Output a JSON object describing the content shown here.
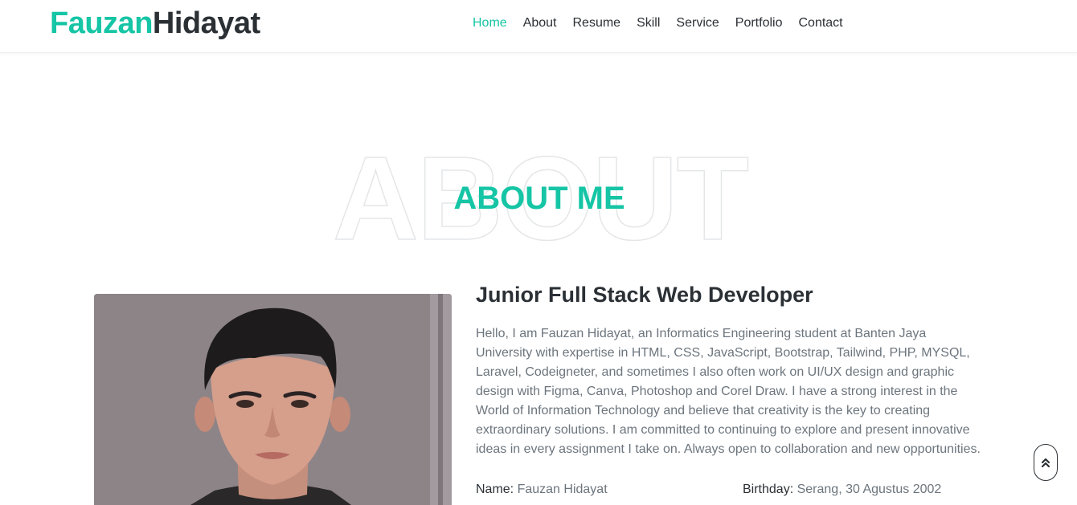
{
  "brand": {
    "first": "Fauzan",
    "last": "Hidayat"
  },
  "nav": {
    "items": [
      {
        "label": "Home",
        "active": true
      },
      {
        "label": "About",
        "active": false
      },
      {
        "label": "Resume",
        "active": false
      },
      {
        "label": "Skill",
        "active": false
      },
      {
        "label": "Service",
        "active": false
      },
      {
        "label": "Portfolio",
        "active": false
      },
      {
        "label": "Contact",
        "active": false
      }
    ]
  },
  "about": {
    "background_word": "ABOUT",
    "title": "ABOUT ME",
    "role": "Junior Full Stack Web Developer",
    "bio": "Hello, I am Fauzan Hidayat, an Informatics Engineering student at Banten Jaya University with expertise in HTML, CSS, JavaScript, Bootstrap, Tailwind, PHP, MYSQL, Laravel, Codeigneter, and sometimes I also often work on UI/UX design and graphic design with Figma, Canva, Photoshop and Corel Draw. I have a strong interest in the World of Information Technology and believe that creativity is the key to creating extraordinary solutions. I am committed to continuing to explore and present innovative ideas in every assignment I take on. Always open to collaboration and new opportunities.",
    "info": [
      {
        "label": "Name:",
        "value": "Fauzan Hidayat"
      },
      {
        "label": "Birthday:",
        "value": "Serang, 30 Agustus 2002"
      }
    ]
  },
  "icons": {
    "scroll_top": "double-chevron-up-icon"
  },
  "colors": {
    "accent": "#15c5a5",
    "text": "#2b3035",
    "muted": "#6c757d"
  }
}
